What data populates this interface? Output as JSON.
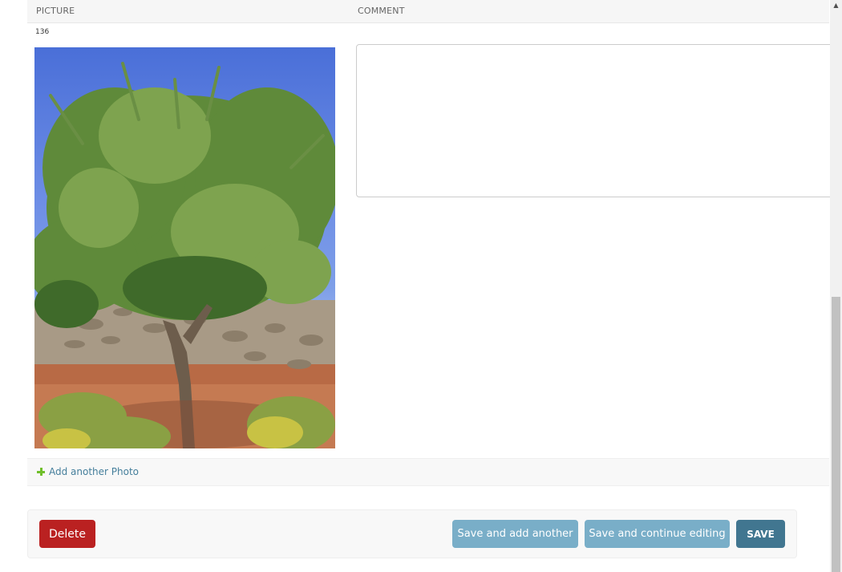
{
  "table": {
    "headers": {
      "picture": "PICTURE",
      "comment": "COMMENT"
    },
    "row": {
      "id": "136",
      "comment_value": ""
    }
  },
  "add_another_label": "Add another Photo",
  "actions": {
    "delete": "Delete",
    "save_add_another": "Save and add another",
    "save_continue": "Save and continue editing",
    "save": "SAVE"
  },
  "colors": {
    "delete": "#ba2121",
    "secondary": "#79aec8",
    "primary": "#417690",
    "link": "#447e9b",
    "add_icon": "#70bf2b"
  },
  "icons": {
    "add": "plus-icon",
    "scroll_up": "scroll-up-arrow-icon"
  }
}
